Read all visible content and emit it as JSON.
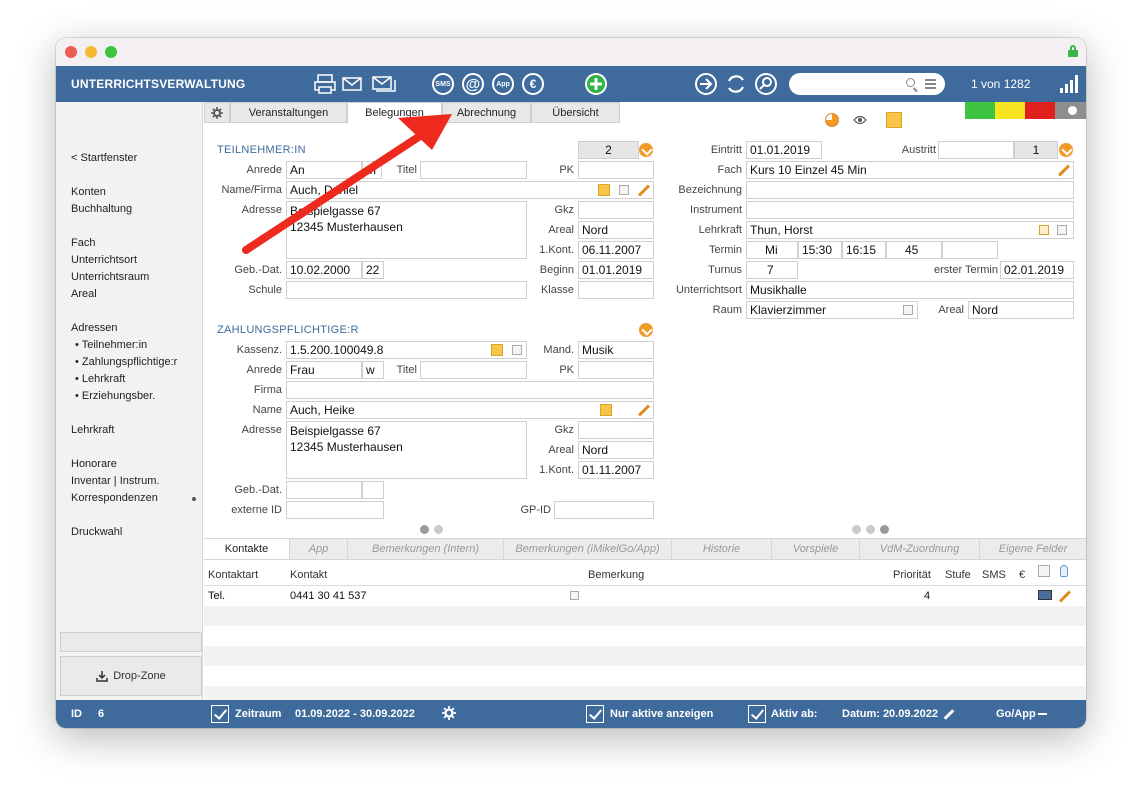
{
  "app": {
    "title": "UNTERRICHTSVERWALTUNG",
    "record_count": "1 von 1282"
  },
  "toolbar": {
    "sms": "SMS",
    "app": "App",
    "at": "@",
    "euro": "€"
  },
  "sidebar": {
    "back": "< Startfenster",
    "items": [
      "Konten",
      "Buchhaltung",
      "Fach",
      "Unterrichtsort",
      "Unterrichtsraum",
      "Areal",
      "Adressen"
    ],
    "address_sub": [
      "• Teilnehmer:in",
      "• Zahlungspflichtige:r",
      "• Lehrkraft",
      "• Erziehungsber."
    ],
    "items2": [
      "Lehrkraft",
      "Honorare",
      "Inventar | Instrum.",
      "Korrespondenzen",
      "Druckwahl"
    ],
    "dropzone": "Drop-Zone"
  },
  "tabs": [
    "Veranstaltungen",
    "Belegungen",
    "Abrechnung",
    "Übersicht"
  ],
  "teilnehmer": {
    "title": "TEILNEHMER:IN",
    "count": "2",
    "labels": {
      "anrede": "Anrede",
      "titel": "Titel",
      "pk": "PK",
      "name": "Name/Firma",
      "adresse": "Adresse",
      "gkz": "Gkz",
      "areal": "Areal",
      "kont": "1.Kont.",
      "geb": "Geb.-Dat.",
      "beginn": "Beginn",
      "schule": "Schule",
      "klasse": "Klasse"
    },
    "anrede": "An",
    "anrede2": "m",
    "name": "Auch, Daniel",
    "adresse": "Beispielgasse 67\n12345 Musterhausen",
    "areal": "Nord",
    "kont": "06.11.2007",
    "geb": "10.02.2000",
    "alter": "22",
    "beginn": "01.01.2019"
  },
  "zahler": {
    "title": "ZAHLUNGSPFLICHTIGE:R",
    "labels": {
      "kassenz": "Kassenz.",
      "mand": "Mand.",
      "anrede": "Anrede",
      "titel": "Titel",
      "pk": "PK",
      "firma": "Firma",
      "name": "Name",
      "adresse": "Adresse",
      "gkz": "Gkz",
      "areal": "Areal",
      "kont": "1.Kont.",
      "geb": "Geb.-Dat.",
      "extid": "externe ID",
      "gpid": "GP-ID"
    },
    "kassenz": "1.5.200.100049.8",
    "mand": "Musik",
    "anrede": "Frau",
    "anrede2": "w",
    "name": "Auch, Heike",
    "adresse": "Beispielgasse 67\n12345 Musterhausen",
    "areal": "Nord",
    "kont": "01.11.2007"
  },
  "belegung": {
    "labels": {
      "eintritt": "Eintritt",
      "austritt": "Austritt",
      "fach": "Fach",
      "bezeichnung": "Bezeichnung",
      "instrument": "Instrument",
      "lehrkraft": "Lehrkraft",
      "termin": "Termin",
      "turnus": "Turnus",
      "erster": "erster Termin",
      "ort": "Unterrichtsort",
      "raum": "Raum",
      "areal": "Areal"
    },
    "eintritt": "01.01.2019",
    "count": "1",
    "fach": "Kurs 10 Einzel 45 Min",
    "lehrkraft": "Thun, Horst",
    "tag": "Mi",
    "von": "15:30",
    "bis": "16:15",
    "dauer": "45",
    "turnus": "7",
    "erster": "02.01.2019",
    "ort": "Musikhalle",
    "raum": "Klavierzimmer",
    "areal": "Nord"
  },
  "bottom_tabs": [
    "Kontakte",
    "App",
    "Bemerkungen (Intern)",
    "Bemerkungen (iMikelGo/App)",
    "Historie",
    "Vorspiele",
    "VdM-Zuordnung",
    "Eigene Felder"
  ],
  "contacts": {
    "headers": {
      "art": "Kontaktart",
      "kontakt": "Kontakt",
      "bem": "Bemerkung",
      "prio": "Priorität",
      "stufe": "Stufe",
      "sms": "SMS",
      "euro": "€"
    },
    "rows": [
      {
        "art": "Tel.",
        "kontakt": "0441 30 41 537",
        "prio": "4"
      }
    ]
  },
  "status": {
    "id_label": "ID",
    "id": "6",
    "zeitraum_label": "Zeitraum",
    "zeitraum": "01.09.2022  -  30.09.2022",
    "nur_aktive": "Nur aktive anzeigen",
    "aktiv_ab": "Aktiv ab:",
    "datum": "Datum: 20.09.2022",
    "goapp": "Go/App"
  },
  "colors": {
    "blue": "#3e6a9c",
    "orange": "#f09a2a",
    "arrow": "#ee2a1f"
  }
}
